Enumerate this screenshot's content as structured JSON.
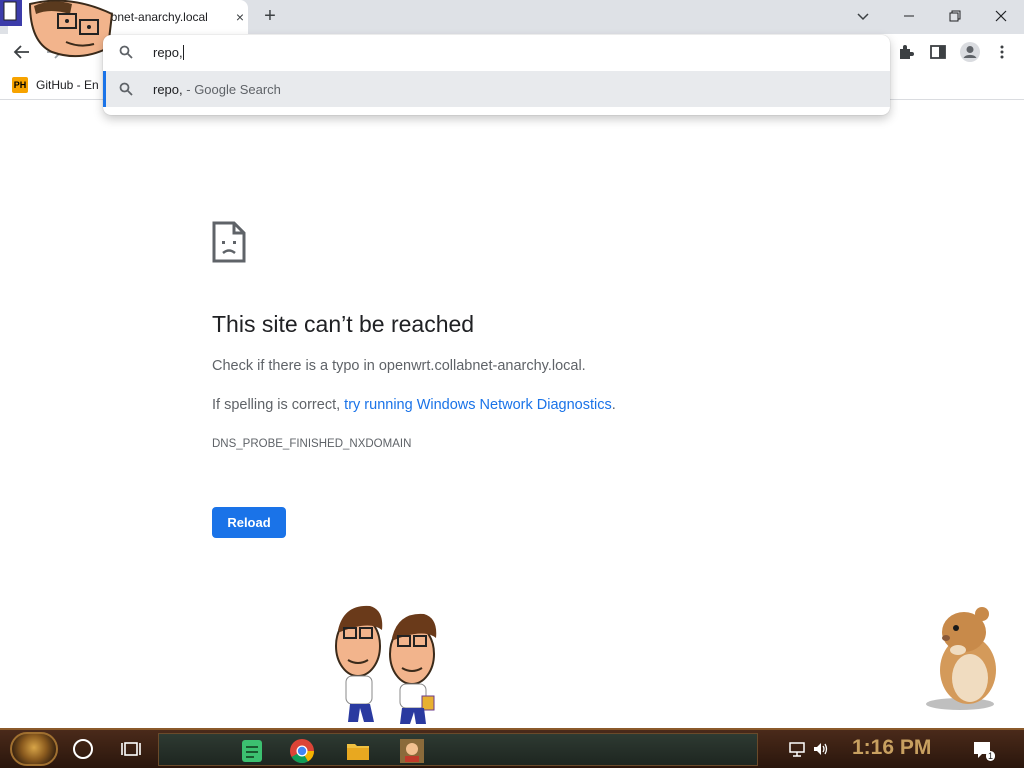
{
  "tab": {
    "title": "abnet-anarchy.local",
    "close_label": "×",
    "new_tab_label": "+"
  },
  "bookmarks": [
    {
      "icon_text": "PH",
      "label": "GitHub - En"
    }
  ],
  "omnibox": {
    "text": "repo,",
    "suggestion": {
      "query": "repo,",
      "suffix": " - Google Search"
    }
  },
  "error": {
    "title": "This site can’t be reached",
    "line1": "Check if there is a typo in openwrt.collabnet-anarchy.local.",
    "line2_prefix": "If spelling is correct, ",
    "line2_link": "try running Windows Network Diagnostics",
    "line2_suffix": ".",
    "code": "DNS_PROBE_FINISHED_NXDOMAIN",
    "reload_label": "Reload"
  },
  "taskbar": {
    "clock": "1:16 PM",
    "notification_count": "1",
    "apps": [
      "notes-icon",
      "chrome-icon",
      "file-explorer-icon",
      "game-icon"
    ]
  },
  "colors": {
    "accent": "#1a73e8",
    "tabstrip": "#dee1e6",
    "clock": "#c8a060"
  }
}
